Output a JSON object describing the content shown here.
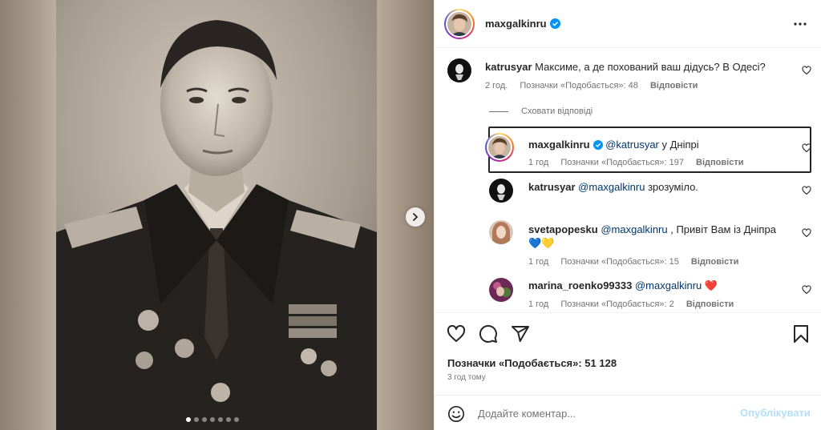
{
  "post": {
    "author": "maxgalkinru",
    "likes_text": "Позначки «Подобається»: 51 128",
    "time_ago": "3 год тому"
  },
  "media": {
    "dots_count": 7,
    "active_dot": 0
  },
  "comments": [
    {
      "user": "katrusyar",
      "text": "Максиме, а де похований ваш дідусь? В Одесі?",
      "time": "2 год.",
      "likes": "Позначки «Подобається»: 48",
      "reply": "Відповісти"
    }
  ],
  "hide_replies_label": "Сховати відповіді",
  "replies": [
    {
      "user": "maxgalkinru",
      "mention": "@katrusyar",
      "text": "у Дніпрі",
      "time": "1 год",
      "likes": "Позначки «Подобається»: 197",
      "reply": "Відповісти"
    },
    {
      "user": "katrusyar",
      "mention": "@maxgalkinru",
      "text": "зрозуміло."
    },
    {
      "user": "svetapopesku",
      "mention": "@maxgalkinru",
      "text": ", Привіт Вам із Дніпра",
      "emoji_line": "💙💛",
      "time": "1 год",
      "likes": "Позначки «Подобається»: 15",
      "reply": "Відповісти"
    },
    {
      "user": "marina_roenko99333",
      "mention": "@maxgalkinru",
      "emoji": "❤️",
      "time": "1 год",
      "likes": "Позначки «Подобається»: 2",
      "reply": "Відповісти"
    }
  ],
  "add_comment": {
    "placeholder": "Додайте коментар...",
    "post_label": "Опублікувати"
  },
  "colors": {
    "verified": "#0095f6",
    "mention": "#00376b",
    "muted": "#737373",
    "post_button_disabled": "#b2dffc"
  },
  "icons": [
    "verified-icon",
    "more-options-icon",
    "heart-icon",
    "comment-icon",
    "share-icon",
    "bookmark-icon",
    "emoji-icon",
    "chevron-right-icon"
  ]
}
